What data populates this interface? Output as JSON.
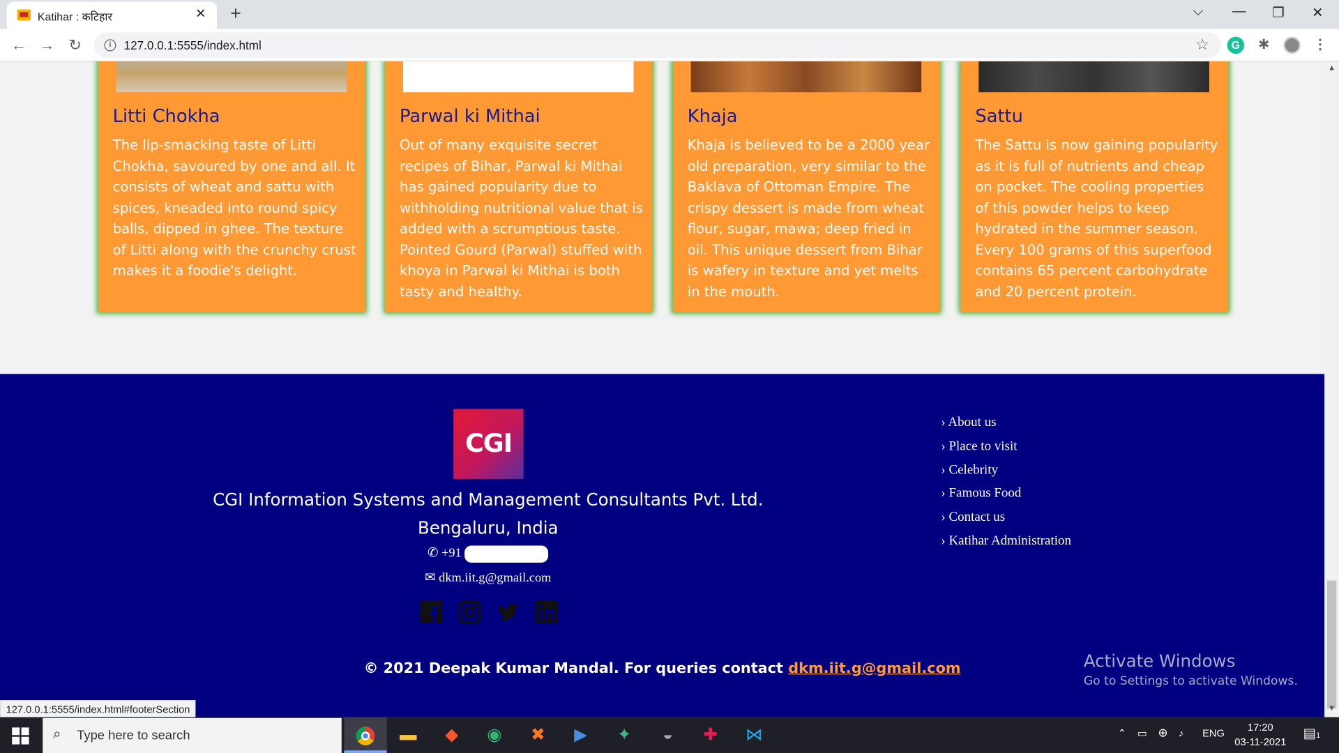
{
  "browser": {
    "tab_title": "Katihar : कटिहार",
    "url": "127.0.0.1:5555/index.html",
    "status_url": "127.0.0.1:5555/index.html#footerSection"
  },
  "cards": [
    {
      "title": "Litti Chokha",
      "text": "The lip-smacking taste of Litti Chokha, savoured by one and all. It consists of wheat and sattu with spices, kneaded into round spicy balls, dipped in ghee. The texture of Litti along with the crunchy crust makes it a foodie's delight."
    },
    {
      "title": "Parwal ki Mithai",
      "text": "Out of many exquisite secret recipes of Bihar, Parwal ki Mithai has gained popularity due to withholding nutritional value that is added with a scrumptious taste. Pointed Gourd (Parwal) stuffed with khoya in Parwal ki Mithai is both tasty and healthy."
    },
    {
      "title": "Khaja",
      "text": "Khaja is believed to be a 2000 year old preparation, very similar to the Baklava of Ottoman Empire. The crispy dessert is made from wheat flour, sugar, mawa; deep fried in oil. This unique dessert from Bihar is wafery in texture and yet melts in the mouth."
    },
    {
      "title": "Sattu",
      "text": "The Sattu is now gaining popularity as it is full of nutrients and cheap on pocket. The cooling properties of this powder helps to keep hydrated in the summer season. Every 100 grams of this superfood contains 65 percent carbohydrate and 20 percent protein."
    }
  ],
  "footer": {
    "logo_text": "CGI",
    "company": "CGI Information Systems and Management Consultants Pvt. Ltd.",
    "location": "Bengaluru, India",
    "phone_prefix": "+91",
    "email": "dkm.iit.g@gmail.com",
    "links": [
      "About us",
      "Place to visit",
      "Celebrity",
      "Famous Food",
      "Contact us",
      "Katihar Administration"
    ],
    "copyright_prefix": "© 2021 Deepak Kumar Mandal. For queries contact ",
    "copyright_email": "dkm.iit.g@gmail.com"
  },
  "watermark": {
    "title": "Activate Windows",
    "subtitle": "Go to Settings to activate Windows."
  },
  "taskbar": {
    "search_placeholder": "Type here to search",
    "language": "ENG",
    "time": "17:20",
    "date": "03-11-2021",
    "notifications": "1"
  }
}
